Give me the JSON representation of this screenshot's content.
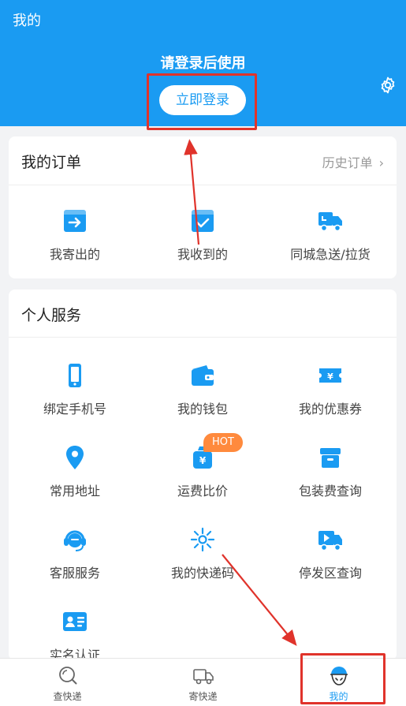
{
  "header": {
    "title": "我的",
    "login_hint": "请登录后使用",
    "login_button": "立即登录"
  },
  "orders": {
    "title": "我的订单",
    "history_link": "历史订单",
    "items": [
      {
        "label": "我寄出的",
        "icon": "send-box-icon"
      },
      {
        "label": "我收到的",
        "icon": "receive-box-icon"
      },
      {
        "label": "同城急送/拉货",
        "icon": "delivery-truck-icon"
      }
    ]
  },
  "services": {
    "title": "个人服务",
    "items": [
      {
        "label": "绑定手机号",
        "icon": "phone-icon"
      },
      {
        "label": "我的钱包",
        "icon": "wallet-icon"
      },
      {
        "label": "我的优惠券",
        "icon": "coupon-icon"
      },
      {
        "label": "常用地址",
        "icon": "location-pin-icon"
      },
      {
        "label": "运费比价",
        "icon": "price-bag-icon",
        "badge": "HOT"
      },
      {
        "label": "包装费查询",
        "icon": "package-icon"
      },
      {
        "label": "客服服务",
        "icon": "headset-icon"
      },
      {
        "label": "我的快递码",
        "icon": "code-burst-icon"
      },
      {
        "label": "停发区查询",
        "icon": "video-truck-icon"
      },
      {
        "label": "实名认证",
        "icon": "id-card-icon"
      }
    ]
  },
  "tabbar": {
    "items": [
      {
        "label": "查快递",
        "icon": "search-icon",
        "active": false
      },
      {
        "label": "寄快递",
        "icon": "truck-outline-icon",
        "active": false
      },
      {
        "label": "我的",
        "icon": "profile-icon",
        "active": true
      }
    ]
  },
  "colors": {
    "brand": "#1a9bf2",
    "highlight": "#e0332b",
    "hot_badge": "#ff8a3d"
  }
}
